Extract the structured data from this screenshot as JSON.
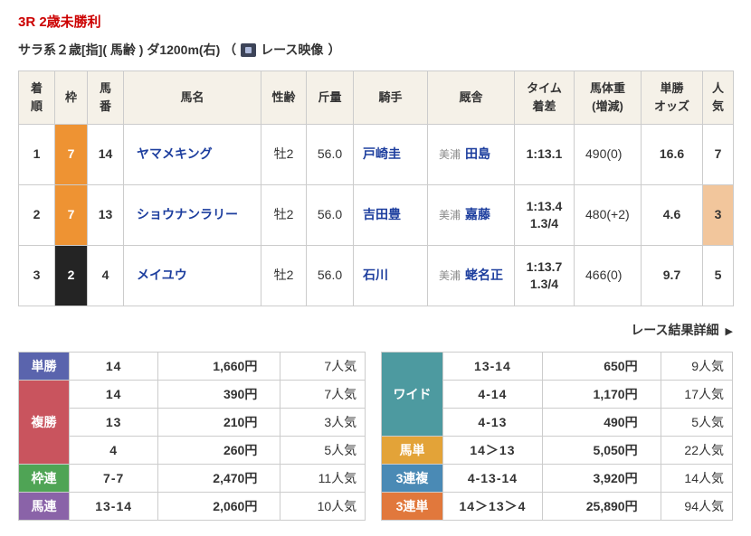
{
  "page": {
    "title": "3R 2歳未勝利",
    "subtitle": "サラ系２歳[指]( 馬齢 ) ダ1200m(右)  （",
    "video_label": "レース映像",
    "subtitle_close": "）",
    "detail_link": "レース結果詳細",
    "detail_arrow": "▶",
    "title_color": "#cc0000",
    "link_color": "#1d3e9e"
  },
  "results": {
    "headers": {
      "pos": "着\n順",
      "frame": "枠",
      "num": "馬\n番",
      "name": "馬名",
      "sexage": "性齢",
      "weight": "斤量",
      "jockey": "騎手",
      "stable": "厩舎",
      "time": "タイム\n着差",
      "body": "馬体重\n(増減)",
      "odds": "単勝\nオッズ",
      "pop": "人\n気"
    },
    "rows": [
      {
        "pos": "1",
        "frame": "7",
        "frame_bg": "#ee9333",
        "num": "14",
        "name": "ヤマメキング",
        "sexage": "牡2",
        "weight": "56.0",
        "jockey": "戸崎圭",
        "region": "美浦",
        "trainer": "田島",
        "time": "1:13.1",
        "margin": "",
        "body": "490(0)",
        "odds": "16.6",
        "pop": "7",
        "pop_bg": ""
      },
      {
        "pos": "2",
        "frame": "7",
        "frame_bg": "#ee9333",
        "num": "13",
        "name": "ショウナンラリー",
        "sexage": "牡2",
        "weight": "56.0",
        "jockey": "吉田豊",
        "region": "美浦",
        "trainer": "嘉藤",
        "time": "1:13.4",
        "margin": "1.3/4",
        "body": "480(+2)",
        "odds": "4.6",
        "pop": "3",
        "pop_bg": "#f2c69c"
      },
      {
        "pos": "3",
        "frame": "2",
        "frame_bg": "#242424",
        "num": "4",
        "name": "メイユウ",
        "sexage": "牡2",
        "weight": "56.0",
        "jockey": "石川",
        "region": "美浦",
        "trainer": "蛯名正",
        "time": "1:13.7",
        "margin": "1.3/4",
        "body": "466(0)",
        "odds": "9.7",
        "pop": "5",
        "pop_bg": ""
      }
    ]
  },
  "payouts_left": {
    "groups": [
      {
        "label": "単勝",
        "color": "#5a64ad",
        "rows": [
          {
            "num": "14",
            "pay": "1,660円",
            "pop": "7人気"
          }
        ]
      },
      {
        "label": "複勝",
        "color": "#c9545e",
        "rows": [
          {
            "num": "14",
            "pay": "390円",
            "pop": "7人気"
          },
          {
            "num": "13",
            "pay": "210円",
            "pop": "3人気"
          },
          {
            "num": "4",
            "pay": "260円",
            "pop": "5人気"
          }
        ]
      },
      {
        "label": "枠連",
        "color": "#4fa455",
        "rows": [
          {
            "num": "7-7",
            "pay": "2,470円",
            "pop": "11人気"
          }
        ]
      },
      {
        "label": "馬連",
        "color": "#8a63a8",
        "rows": [
          {
            "num": "13-14",
            "pay": "2,060円",
            "pop": "10人気"
          }
        ]
      }
    ]
  },
  "payouts_right": {
    "groups": [
      {
        "label": "ワイド",
        "color": "#4d9aa0",
        "rows": [
          {
            "num": "13-14",
            "pay": "650円",
            "pop": "9人気"
          },
          {
            "num": "4-14",
            "pay": "1,170円",
            "pop": "17人気"
          },
          {
            "num": "4-13",
            "pay": "490円",
            "pop": "5人気"
          }
        ]
      },
      {
        "label": "馬単",
        "color": "#e3a338",
        "rows": [
          {
            "num": "14＞13",
            "pay": "5,050円",
            "pop": "22人気"
          }
        ]
      },
      {
        "label": "3連複",
        "color": "#4a8ab5",
        "rows": [
          {
            "num": "4-13-14",
            "pay": "3,920円",
            "pop": "14人気"
          }
        ]
      },
      {
        "label": "3連単",
        "color": "#e1783c",
        "rows": [
          {
            "num": "14＞13＞4",
            "pay": "25,890円",
            "pop": "94人気"
          }
        ]
      }
    ]
  }
}
